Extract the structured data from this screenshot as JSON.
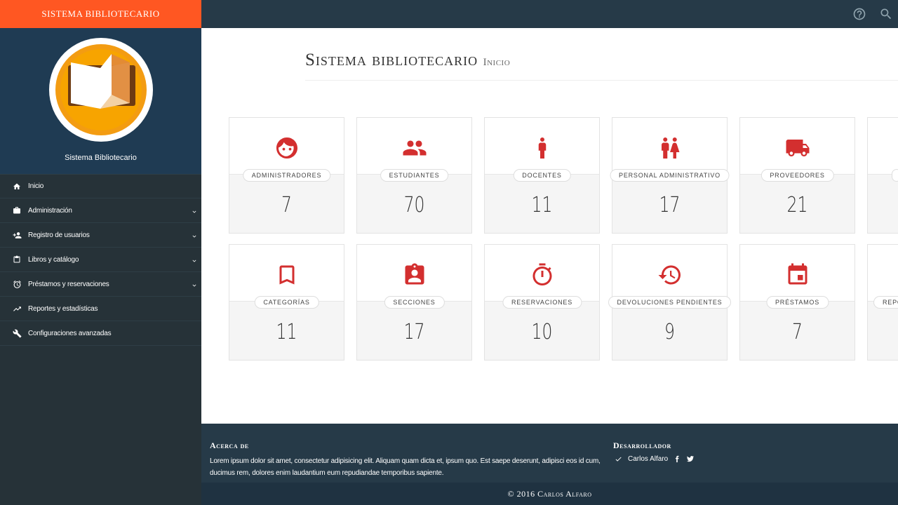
{
  "brand": "SISTEMA BIBLIOTECARIO",
  "profile": {
    "name": "Sistema Bibliotecario"
  },
  "menu": [
    {
      "label": "Inicio",
      "icon": "home-icon",
      "expandable": false
    },
    {
      "label": "Administración",
      "icon": "briefcase-icon",
      "expandable": true
    },
    {
      "label": "Registro de usuarios",
      "icon": "person-add-icon",
      "expandable": true
    },
    {
      "label": "Libros y catálogo",
      "icon": "clipboard-icon",
      "expandable": true
    },
    {
      "label": "Préstamos y reservaciones",
      "icon": "alarm-icon",
      "expandable": true
    },
    {
      "label": "Reportes y estadísticas",
      "icon": "trending-up-icon",
      "expandable": false
    },
    {
      "label": "Configuraciones avanzadas",
      "icon": "wrench-icon",
      "expandable": false
    }
  ],
  "topbar": {
    "help_icon": "help-icon",
    "search_icon": "search-icon"
  },
  "header": {
    "title": "Sistema bibliotecario",
    "subtitle": "Inicio"
  },
  "colors": {
    "accent": "#ff5722",
    "icon_red": "#d32f2f",
    "sidebar": "#263238",
    "sidebar_profile": "#1f3b53",
    "topbar": "#263a48"
  },
  "tiles": [
    [
      {
        "label": "ADMINISTRADORES",
        "value": "7",
        "icon": "face-icon"
      },
      {
        "label": "ESTUDIANTES",
        "value": "70",
        "icon": "people-icon"
      },
      {
        "label": "DOCENTES",
        "value": "11",
        "icon": "person-icon"
      },
      {
        "label": "PERSONAL ADMINISTRATIVO",
        "value": "17",
        "icon": "wc-icon"
      },
      {
        "label": "PROVEEDORES",
        "value": "21",
        "icon": "truck-icon"
      },
      {
        "label": "",
        "value": "",
        "icon": ""
      }
    ],
    [
      {
        "label": "CATEGORÍAS",
        "value": "11",
        "icon": "bookmark-icon"
      },
      {
        "label": "SECCIONES",
        "value": "17",
        "icon": "badge-icon"
      },
      {
        "label": "RESERVACIONES",
        "value": "10",
        "icon": "timer-icon"
      },
      {
        "label": "DEVOLUCIONES PENDIENTES",
        "value": "9",
        "icon": "history-icon"
      },
      {
        "label": "PRÉSTAMOS",
        "value": "7",
        "icon": "event-icon"
      },
      {
        "label": "REPO",
        "value": "",
        "icon": ""
      }
    ]
  ],
  "footer": {
    "about_title": "Acerca de",
    "about_text": "Lorem ipsum dolor sit amet, consectetur adipisicing elit. Aliquam quam dicta et, ipsum quo. Est saepe deserunt, adipisci eos id cum, ducimus rem, dolores enim laudantium eum repudiandae temporibus sapiente.",
    "dev_title": "Desarrollador",
    "dev_name": "Carlos Alfaro",
    "copyright": "© 2016 Carlos Alfaro"
  }
}
